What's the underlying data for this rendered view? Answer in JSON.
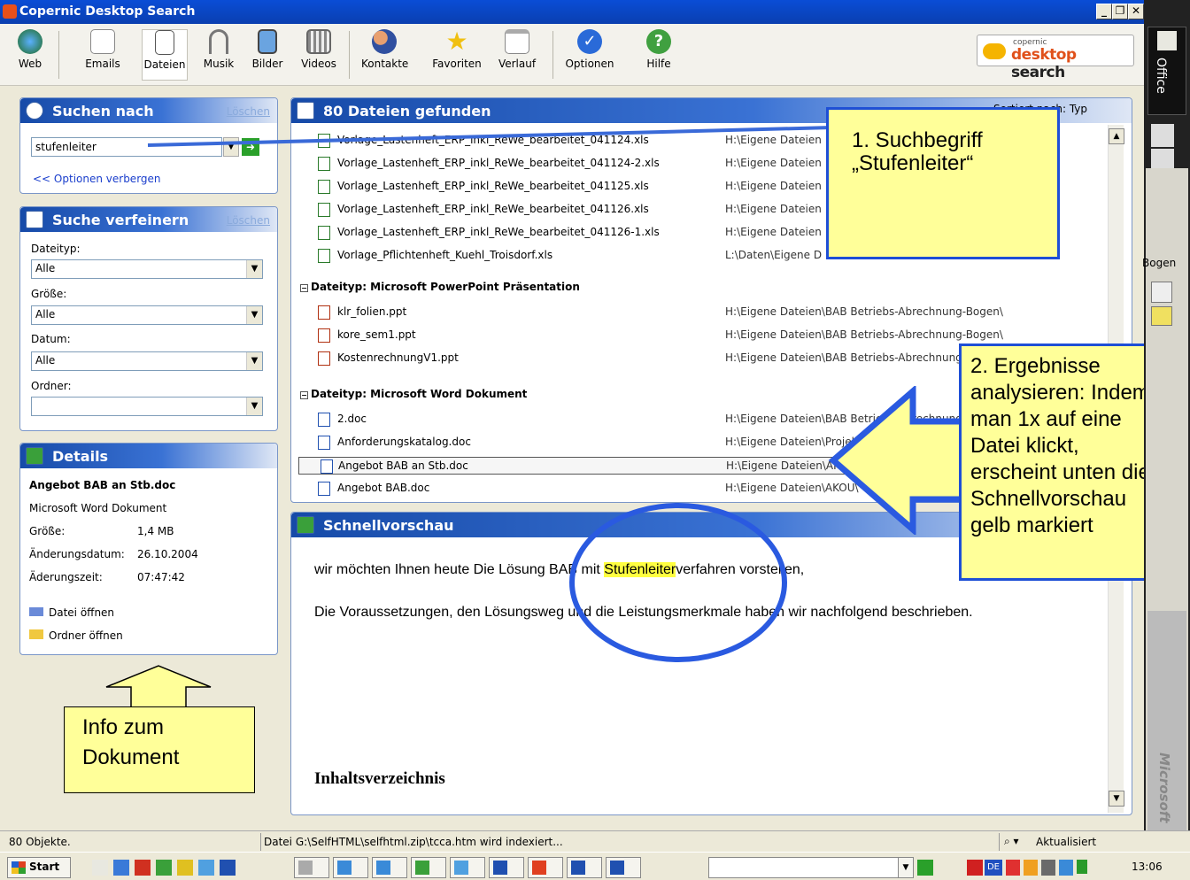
{
  "app": {
    "title": "Copernic Desktop Search"
  },
  "toolbar": {
    "buttons": [
      "Web",
      "Emails",
      "Dateien",
      "Musik",
      "Bilder",
      "Videos",
      "Kontakte",
      "Favoriten",
      "Verlauf",
      "Optionen",
      "Hilfe"
    ],
    "logo_small": "copernic",
    "logo_big_a": "desktop",
    "logo_big_b": "search"
  },
  "search": {
    "title": "Suchen nach",
    "clear": "Löschen",
    "value": "stufenleiter",
    "options_link": "<< Optionen verbergen"
  },
  "refine": {
    "title": "Suche verfeinern",
    "clear": "Löschen",
    "fields": [
      {
        "label": "Dateityp:",
        "value": "Alle"
      },
      {
        "label": "Größe:",
        "value": "Alle"
      },
      {
        "label": "Datum:",
        "value": "Alle"
      },
      {
        "label": "Ordner:",
        "value": ""
      }
    ]
  },
  "details": {
    "title": "Details",
    "filename": "Angebot BAB an Stb.doc",
    "type": "Microsoft Word Dokument",
    "size_label": "Größe:",
    "size_value": "1,4 MB",
    "date_label": "Änderungsdatum:",
    "date_value": "26.10.2004",
    "time_label": "Äderungszeit:",
    "time_value": "07:47:42",
    "open_file": "Datei öffnen",
    "open_folder": "Ordner öffnen"
  },
  "results": {
    "title": "80 Dateien gefunden",
    "sort": "Sortiert nach: Typ",
    "rows_xls": [
      {
        "name": "Vorlage_Lastenheft_ERP_inkl_ReWe_bearbeitet_041124.xls",
        "path": "H:\\Eigene Dateien"
      },
      {
        "name": "Vorlage_Lastenheft_ERP_inkl_ReWe_bearbeitet_041124-2.xls",
        "path": "H:\\Eigene Dateien"
      },
      {
        "name": "Vorlage_Lastenheft_ERP_inkl_ReWe_bearbeitet_041125.xls",
        "path": "H:\\Eigene Dateien"
      },
      {
        "name": "Vorlage_Lastenheft_ERP_inkl_ReWe_bearbeitet_041126.xls",
        "path": "H:\\Eigene Dateien"
      },
      {
        "name": "Vorlage_Lastenheft_ERP_inkl_ReWe_bearbeitet_041126-1.xls",
        "path": "H:\\Eigene Dateien"
      },
      {
        "name": "Vorlage_Pflichtenheft_Kuehl_Troisdorf.xls",
        "path": "L:\\Daten\\Eigene D"
      }
    ],
    "group_ppt": "Dateityp: Microsoft PowerPoint Präsentation",
    "rows_ppt": [
      {
        "name": "klr_folien.ppt",
        "path": "H:\\Eigene Dateien\\BAB Betriebs-Abrechnung-Bogen\\"
      },
      {
        "name": "kore_sem1.ppt",
        "path": "H:\\Eigene Dateien\\BAB Betriebs-Abrechnung-Bogen\\"
      },
      {
        "name": "KostenrechnungV1.ppt",
        "path": "H:\\Eigene Dateien\\BAB Betriebs-Abrechnung-Bogen\\"
      }
    ],
    "group_doc": "Dateityp: Microsoft Word Dokument",
    "rows_doc": [
      {
        "name": "2.doc",
        "path": "H:\\Eigene Dateien\\BAB Betriebs-Abrechnung-Bogen\\"
      },
      {
        "name": "Anforderungskatalog.doc",
        "path": "H:\\Eigene Dateien\\Projekte\\"
      },
      {
        "name": "Angebot BAB an Stb.doc",
        "path": "H:\\Eigene Dateien\\AKOU\\"
      },
      {
        "name": "Angebot BAB.doc",
        "path": "H:\\Eigene Dateien\\AKOU\\"
      }
    ]
  },
  "preview": {
    "title": "Schnellvorschau",
    "line1_pre": "wir möchten Ihnen heute Die Lösung BAB mit ",
    "line1_hl": "Stufenleiter",
    "line1_post": "verfahren vorstellen,",
    "line2": "Die Voraussetzungen, den Lösungsweg und die Leistungsmerkmale haben wir nachfolgend beschrieben.",
    "heading": "Inhaltsverzeichnis"
  },
  "notes": {
    "n1": "1. Suchbegriff „Stufenleiter“",
    "n2": "2. Ergebnisse analysieren: Indem man 1x auf eine Datei klickt, erscheint unten die Schnellvorschau gelb markiert",
    "n3": "Info zum Dokument"
  },
  "status": {
    "left": "80 Objekte.",
    "middle": "Datei G:\\SelfHTML\\selfhtml.zip\\tcca.htm wird indexiert...",
    "right": "Aktualisiert"
  },
  "taskbar": {
    "start": "Start",
    "lang": "DE",
    "clock": "13:06"
  },
  "sidebar": {
    "office": "Office",
    "bogen": "Bogen",
    "microsoft": "Microsoft"
  }
}
